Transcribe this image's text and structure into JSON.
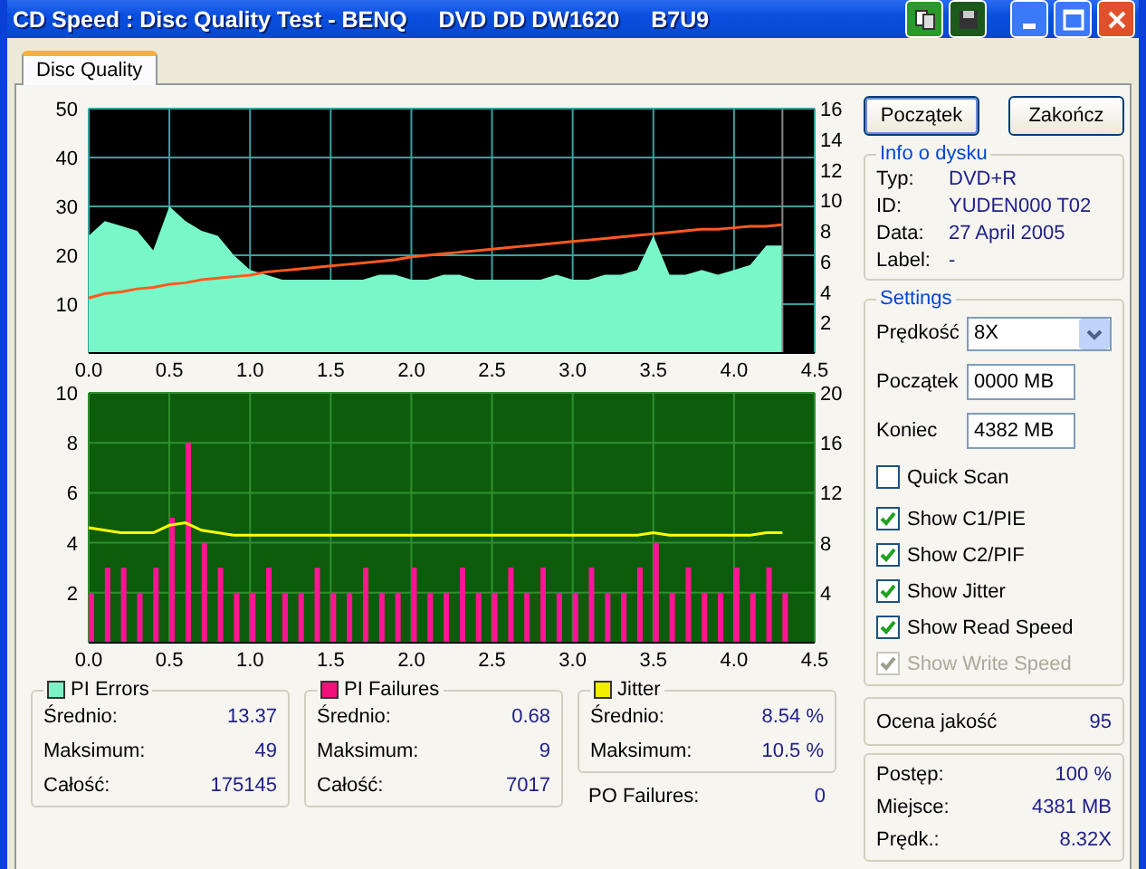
{
  "window": {
    "title": "CD Speed : Disc Quality Test - BENQ     DVD DD DW1620     B7U9"
  },
  "tabs": [
    {
      "label": "Disc Quality",
      "selected": true
    }
  ],
  "charts": [
    {
      "chart_data": {
        "type": "area",
        "x": [
          0.0,
          0.1,
          0.2,
          0.3,
          0.4,
          0.5,
          0.6,
          0.7,
          0.8,
          0.9,
          1.0,
          1.1,
          1.2,
          1.3,
          1.4,
          1.5,
          1.6,
          1.7,
          1.8,
          1.9,
          2.0,
          2.1,
          2.2,
          2.3,
          2.4,
          2.5,
          2.6,
          2.7,
          2.8,
          2.9,
          3.0,
          3.1,
          3.2,
          3.3,
          3.4,
          3.5,
          3.6,
          3.7,
          3.8,
          3.9,
          4.0,
          4.1,
          4.2,
          4.3
        ],
        "series": [
          {
            "color": "#78f8c8",
            "values": [
              24,
              27,
              26,
              25,
              21,
              30,
              27,
              25,
              24,
              20,
              17,
              16,
              15,
              15,
              15,
              15,
              15,
              15,
              16,
              16,
              15,
              15,
              16,
              16,
              15,
              15,
              15,
              15,
              15,
              16,
              15,
              15,
              16,
              16,
              17,
              24,
              16,
              16,
              17,
              16,
              17,
              18,
              22,
              22
            ]
          },
          {
            "axis": "y2",
            "type": "line",
            "color": "#ff5a1e",
            "values": [
              3.6,
              3.9,
              4.0,
              4.2,
              4.3,
              4.5,
              4.6,
              4.8,
              4.9,
              5.0,
              5.1,
              5.3,
              5.4,
              5.5,
              5.6,
              5.7,
              5.8,
              5.9,
              6.0,
              6.1,
              6.3,
              6.4,
              6.5,
              6.6,
              6.7,
              6.8,
              6.9,
              7.0,
              7.1,
              7.2,
              7.3,
              7.4,
              7.5,
              7.6,
              7.7,
              7.8,
              7.9,
              8.0,
              8.1,
              8.1,
              8.2,
              8.3,
              8.3,
              8.4
            ]
          }
        ],
        "xlim": [
          0,
          4.5
        ],
        "ylim": [
          0,
          50
        ],
        "y2lim": [
          0,
          16
        ],
        "xticks": [
          {
            "value": 0,
            "label": "0.0"
          },
          {
            "value": 0.5,
            "label": "0.5"
          },
          {
            "value": 1,
            "label": "1.0"
          },
          {
            "value": 1.5,
            "label": "1.5"
          },
          {
            "value": 2,
            "label": "2.0"
          },
          {
            "value": 2.5,
            "label": "2.5"
          },
          {
            "value": 3,
            "label": "3.0"
          },
          {
            "value": 3.5,
            "label": "3.5"
          },
          {
            "value": 4,
            "label": "4.0"
          },
          {
            "value": 4.5,
            "label": "4.5"
          }
        ],
        "yticks": [
          10,
          20,
          30,
          40,
          50
        ],
        "y2ticks": [
          2,
          4,
          6,
          8,
          10,
          12,
          14,
          16
        ],
        "grid": true,
        "ref_lines": [
          {
            "axis": "x",
            "value": 4.3,
            "color": "#888888"
          }
        ]
      }
    },
    {
      "chart_data": {
        "type": "bar",
        "x": [
          0.0,
          0.1,
          0.2,
          0.3,
          0.4,
          0.5,
          0.6,
          0.7,
          0.8,
          0.9,
          1.0,
          1.1,
          1.2,
          1.3,
          1.4,
          1.5,
          1.6,
          1.7,
          1.8,
          1.9,
          2.0,
          2.1,
          2.2,
          2.3,
          2.4,
          2.5,
          2.6,
          2.7,
          2.8,
          2.9,
          3.0,
          3.1,
          3.2,
          3.3,
          3.4,
          3.5,
          3.6,
          3.7,
          3.8,
          3.9,
          4.0,
          4.1,
          4.2,
          4.3
        ],
        "series": [
          {
            "color": "#ff1493",
            "values": [
              2,
              3,
              3,
              2,
              3,
              5,
              8,
              4,
              3,
              2,
              2,
              3,
              2,
              2,
              3,
              2,
              2,
              3,
              2,
              2,
              3,
              2,
              2,
              3,
              2,
              2,
              3,
              2,
              3,
              2,
              2,
              3,
              2,
              2,
              3,
              4,
              2,
              3,
              2,
              2,
              3,
              2,
              3,
              2
            ]
          },
          {
            "axis": "y2",
            "type": "line",
            "color": "#ffff00",
            "values": [
              9.2,
              9.0,
              8.8,
              8.8,
              8.8,
              9.4,
              9.6,
              9.0,
              8.8,
              8.6,
              8.6,
              8.6,
              8.6,
              8.6,
              8.6,
              8.6,
              8.6,
              8.6,
              8.6,
              8.6,
              8.6,
              8.6,
              8.6,
              8.6,
              8.6,
              8.6,
              8.6,
              8.6,
              8.6,
              8.6,
              8.6,
              8.6,
              8.6,
              8.6,
              8.6,
              8.8,
              8.6,
              8.6,
              8.6,
              8.6,
              8.6,
              8.6,
              8.8,
              8.8
            ]
          }
        ],
        "xlim": [
          0,
          4.5
        ],
        "ylim": [
          0,
          10
        ],
        "y2lim": [
          0,
          20
        ],
        "xticks": [
          {
            "value": 0,
            "label": "0.0"
          },
          {
            "value": 0.5,
            "label": "0.5"
          },
          {
            "value": 1,
            "label": "1.0"
          },
          {
            "value": 1.5,
            "label": "1.5"
          },
          {
            "value": 2,
            "label": "2.0"
          },
          {
            "value": 2.5,
            "label": "2.5"
          },
          {
            "value": 3,
            "label": "3.0"
          },
          {
            "value": 3.5,
            "label": "3.5"
          },
          {
            "value": 4,
            "label": "4.0"
          },
          {
            "value": 4.5,
            "label": "4.5"
          }
        ],
        "yticks": [
          2,
          4,
          6,
          8,
          10
        ],
        "y2ticks": [
          4,
          8,
          12,
          16,
          20
        ],
        "grid": true
      }
    }
  ],
  "buttons": [
    "Początek",
    "Zakończ"
  ],
  "disc_info": {
    "title": "Info o dysku",
    "rows": [
      {
        "label": "Typ:",
        "value": "DVD+R"
      },
      {
        "label": "ID:",
        "value": "YUDEN000 T02"
      },
      {
        "label": "Data:",
        "value": "27 April 2005"
      },
      {
        "label": "Label:",
        "value": "-"
      }
    ]
  },
  "settings": {
    "title": "Settings",
    "speed": {
      "label": "Prędkość",
      "value": "8X"
    },
    "fields": [
      {
        "label": "Początek",
        "value": "0000 MB"
      },
      {
        "label": "Koniec",
        "value": "4382 MB"
      }
    ],
    "options": [
      {
        "label": "Quick Scan",
        "checked": false,
        "disabled": false
      },
      {
        "label": "Show C1/PIE",
        "checked": true,
        "disabled": false
      },
      {
        "label": "Show C2/PIF",
        "checked": true,
        "disabled": false
      },
      {
        "label": "Show Jitter",
        "checked": true,
        "disabled": false
      },
      {
        "label": "Show Read Speed",
        "checked": true,
        "disabled": false
      },
      {
        "label": "Show Write Speed",
        "checked": true,
        "disabled": true
      }
    ]
  },
  "stats": [
    {
      "title": "PI Errors",
      "color": "#80f0c8",
      "rows": [
        {
          "label": "Średnio:",
          "value": "13.37"
        },
        {
          "label": "Maksimum:",
          "value": "49"
        },
        {
          "label": "Całość:",
          "value": "175145"
        }
      ]
    },
    {
      "title": "PI Failures",
      "color": "#f0107a",
      "rows": [
        {
          "label": "Średnio:",
          "value": "0.68"
        },
        {
          "label": "Maksimum:",
          "value": "9"
        },
        {
          "label": "Całość:",
          "value": "7017"
        }
      ]
    },
    {
      "title": "Jitter",
      "color": "#f0f000",
      "rows": [
        {
          "label": "Średnio:",
          "value": "8.54 %"
        },
        {
          "label": "Maksimum:",
          "value": "10.5 %"
        }
      ]
    }
  ],
  "po_failures": {
    "label": "PO Failures:",
    "value": "0"
  },
  "quality": {
    "label": "Ocena jakość",
    "value": "95"
  },
  "progress": [
    {
      "label": "Postęp:",
      "value": "100 %"
    },
    {
      "label": "Miejsce:",
      "value": "4381 MB"
    },
    {
      "label": "Prędk.:",
      "value": "8.32X"
    }
  ]
}
